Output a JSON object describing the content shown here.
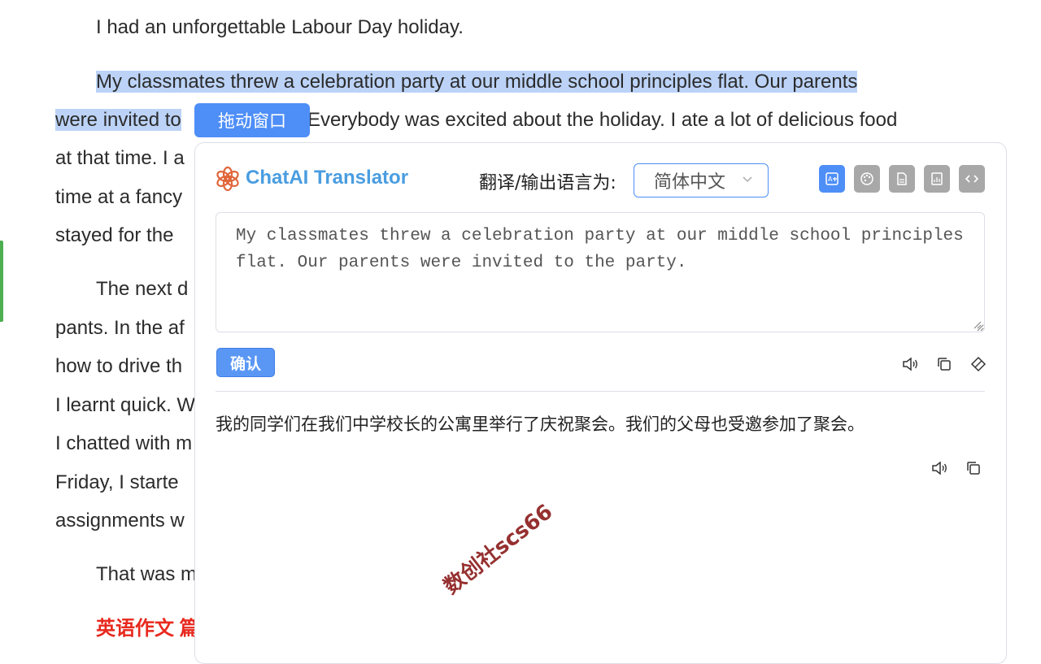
{
  "article": {
    "para1": "I had an unforgettable Labour Day holiday.",
    "para2_line1": "My classmates threw a celebration party at our middle school principles flat. Our parents",
    "para2_line2_a": "were invited to",
    "para2_line2_b": "Everybody was excited about the holiday. I ate a lot of delicious food",
    "line3": "at that time. I a",
    "line4": "time at a fancy",
    "line5": "stayed for the",
    "para3_line1": "The next d",
    "line7": "pants. In the af",
    "line8": "how to drive th",
    "line9": "I learnt quick. W",
    "line10": "I chatted with m",
    "line11": "Friday, I starte",
    "line12": "assignments w",
    "para4": "That was m",
    "heading": "英语作文 篇"
  },
  "drag_handle": {
    "label": "拖动窗口"
  },
  "translator": {
    "brand": "ChatAI Translator",
    "output_language_label": "翻译/输出语言为:",
    "selected_language": "简体中文",
    "toolbar_icons": [
      "translate-image-icon",
      "palette-icon",
      "document-icon",
      "spreadsheet-icon",
      "code-icon"
    ],
    "source_text": "My classmates threw a celebration party at our middle school principles flat. Our parents were invited to the party.",
    "confirm_label": "确认",
    "result_text": "我的同学们在我们中学校长的公寓里举行了庆祝聚会。我们的父母也受邀参加了聚会。"
  },
  "watermark": "数创社scs66",
  "colors": {
    "accent": "#4e8ef7",
    "brand": "#4a9de0",
    "highlight": "#bcd3f7",
    "heading": "#e8291e"
  }
}
